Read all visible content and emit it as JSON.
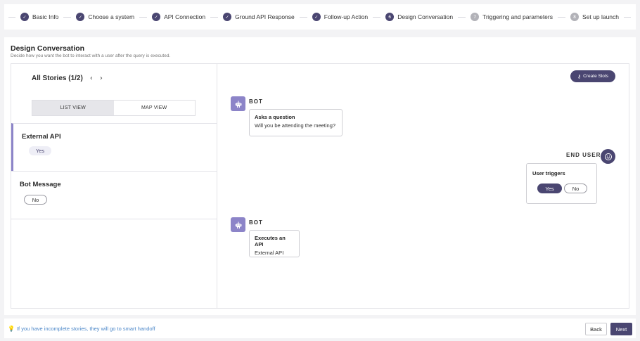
{
  "stepper": {
    "steps": [
      {
        "label": "Basic Info",
        "state": "done",
        "icon": "check-icon"
      },
      {
        "label": "Choose a system",
        "state": "done",
        "icon": "check-icon"
      },
      {
        "label": "API Connection",
        "state": "done",
        "icon": "check-icon"
      },
      {
        "label": "Ground API Response",
        "state": "done",
        "icon": "check-icon"
      },
      {
        "label": "Follow-up Action",
        "state": "done",
        "icon": "check-icon"
      },
      {
        "label": "Design Conversation",
        "state": "active",
        "number": "6"
      },
      {
        "label": "Triggering and parameters",
        "state": "pending",
        "number": "7"
      },
      {
        "label": "Set up launch",
        "state": "pending",
        "number": "8"
      }
    ]
  },
  "main": {
    "title": "Design Conversation",
    "subtitle": "Decide how you want the bot to interact with a user after the query is executed."
  },
  "stories": {
    "title": "All Stories (1/2)",
    "prev_icon": "chevron-left-icon",
    "next_icon": "chevron-right-icon",
    "views": {
      "list": "LIST VIEW",
      "map": "MAP VIEW",
      "selected": "list"
    },
    "cards": [
      {
        "name": "External API",
        "value": "Yes",
        "selected": true
      },
      {
        "name": "Bot Message",
        "value": "No",
        "selected": false
      }
    ]
  },
  "conversation": {
    "create_slots_label": "Create Slots",
    "create_slots_icon": "key-icon",
    "bot_label": "BOT",
    "end_user_label": "END USER",
    "messages": [
      {
        "title": "Asks a question",
        "text": "Will you be attending the meeting?"
      },
      {
        "title": "Executes an API",
        "text": "External API"
      }
    ],
    "user_trigger": {
      "title": "User triggers",
      "options": [
        "Yes",
        "No"
      ],
      "selected": "Yes"
    }
  },
  "footer": {
    "note": "If you have incomplete stories, they will go to smart handoff",
    "note_icon": "lightbulb-icon",
    "back_label": "Back",
    "next_label": "Next"
  },
  "colors": {
    "accent": "#4a4671",
    "bot": "#8c84c8",
    "link": "#4a86c8"
  }
}
